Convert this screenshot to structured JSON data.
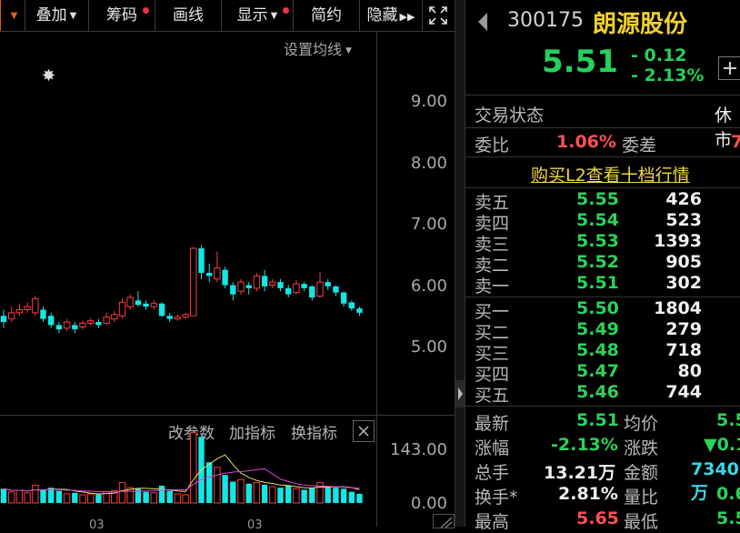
{
  "toolbar": {
    "stack_label": "叠加",
    "chips_label": "筹码",
    "draw_label": "画线",
    "display_label": "显示",
    "simple_label": "简约",
    "hide_label": "隐藏"
  },
  "chart": {
    "ma_setting_label": "设置均线",
    "price_ticks": [
      "9.00",
      "8.00",
      "7.00",
      "6.00",
      "5.00"
    ],
    "volume_ticks": [
      "143.00",
      "0.00"
    ],
    "indicator_buttons": {
      "change_params": "改参数",
      "add_indicator": "加指标",
      "switch_indicator": "换指标"
    },
    "x_ticks": [
      "03",
      "03"
    ]
  },
  "stock": {
    "code": "300175",
    "name": "朗源股份",
    "price": "5.51",
    "change": "- 0.12",
    "change_pct": "- 2.13%"
  },
  "status": {
    "trade_status_label": "交易状态",
    "trade_status_value": "休市",
    "commission_ratio_label": "委比",
    "commission_ratio_value": "1.06%",
    "commission_diff_label": "委差",
    "commission_diff_value": "7"
  },
  "l2_link": "购买L2查看十档行情",
  "order_book": {
    "asks": [
      {
        "label": "卖五",
        "price": "5.55",
        "volume": "426"
      },
      {
        "label": "卖四",
        "price": "5.54",
        "volume": "523"
      },
      {
        "label": "卖三",
        "price": "5.53",
        "volume": "1393"
      },
      {
        "label": "卖二",
        "price": "5.52",
        "volume": "905"
      },
      {
        "label": "卖一",
        "price": "5.51",
        "volume": "302"
      }
    ],
    "bids": [
      {
        "label": "买一",
        "price": "5.50",
        "volume": "1804"
      },
      {
        "label": "买二",
        "price": "5.49",
        "volume": "279"
      },
      {
        "label": "买三",
        "price": "5.48",
        "volume": "718"
      },
      {
        "label": "买四",
        "price": "5.47",
        "volume": "80"
      },
      {
        "label": "买五",
        "price": "5.46",
        "volume": "744"
      }
    ]
  },
  "stats": {
    "latest_label": "最新",
    "latest_value": "5.51",
    "avg_label": "均价",
    "avg_value": "5.5",
    "pct_label": "涨幅",
    "pct_value": "-2.13%",
    "chg_label": "涨跌",
    "chg_value": "▼0.1",
    "vol_label": "总手",
    "vol_value": "13.21万",
    "amount_label": "金额",
    "amount_value": "7340万",
    "turnover_label": "换手*",
    "turnover_value": "2.81%",
    "vol_ratio_label": "量比",
    "vol_ratio_value": "0.6",
    "high_label": "最高",
    "high_value": "5.65",
    "low_label": "最低",
    "low_value": "5.5"
  },
  "colors": {
    "up": "#ff3b3b",
    "down": "#14e6e6",
    "price_green": "#26d05a",
    "name_yellow": "#f0d030",
    "ma_yellow": "#e8e060",
    "ma_magenta": "#e040e0"
  },
  "chart_data": {
    "type": "candlestick",
    "y_axis_ticks": [
      5.0,
      6.0,
      7.0,
      8.0,
      9.0
    ],
    "candles": [
      {
        "o": 5.5,
        "c": 5.4,
        "h": 5.6,
        "l": 5.3
      },
      {
        "o": 5.45,
        "c": 5.55,
        "h": 5.65,
        "l": 5.4
      },
      {
        "o": 5.55,
        "c": 5.6,
        "h": 5.7,
        "l": 5.5
      },
      {
        "o": 5.6,
        "c": 5.65,
        "h": 5.72,
        "l": 5.55
      },
      {
        "o": 5.55,
        "c": 5.78,
        "h": 5.82,
        "l": 5.5
      },
      {
        "o": 5.6,
        "c": 5.45,
        "h": 5.65,
        "l": 5.4
      },
      {
        "o": 5.5,
        "c": 5.35,
        "h": 5.55,
        "l": 5.3
      },
      {
        "o": 5.35,
        "c": 5.28,
        "h": 5.4,
        "l": 5.22
      },
      {
        "o": 5.3,
        "c": 5.4,
        "h": 5.45,
        "l": 5.25
      },
      {
        "o": 5.35,
        "c": 5.28,
        "h": 5.4,
        "l": 5.22
      },
      {
        "o": 5.32,
        "c": 5.38,
        "h": 5.42,
        "l": 5.28
      },
      {
        "o": 5.38,
        "c": 5.42,
        "h": 5.46,
        "l": 5.34
      },
      {
        "o": 5.4,
        "c": 5.35,
        "h": 5.45,
        "l": 5.3
      },
      {
        "o": 5.38,
        "c": 5.48,
        "h": 5.55,
        "l": 5.35
      },
      {
        "o": 5.45,
        "c": 5.52,
        "h": 5.58,
        "l": 5.4
      },
      {
        "o": 5.5,
        "c": 5.72,
        "h": 5.78,
        "l": 5.45
      },
      {
        "o": 5.65,
        "c": 5.8,
        "h": 5.85,
        "l": 5.6
      },
      {
        "o": 5.75,
        "c": 5.68,
        "h": 5.9,
        "l": 5.65
      },
      {
        "o": 5.7,
        "c": 5.65,
        "h": 5.75,
        "l": 5.6
      },
      {
        "o": 5.65,
        "c": 5.7,
        "h": 5.75,
        "l": 5.6
      },
      {
        "o": 5.7,
        "c": 5.5,
        "h": 5.72,
        "l": 5.48
      },
      {
        "o": 5.5,
        "c": 5.45,
        "h": 5.55,
        "l": 5.4
      },
      {
        "o": 5.45,
        "c": 5.48,
        "h": 5.52,
        "l": 5.42
      },
      {
        "o": 5.48,
        "c": 5.52,
        "h": 5.55,
        "l": 5.45
      },
      {
        "o": 5.5,
        "c": 6.6,
        "h": 6.62,
        "l": 5.5
      },
      {
        "o": 6.6,
        "c": 6.2,
        "h": 6.65,
        "l": 6.1
      },
      {
        "o": 6.2,
        "c": 6.15,
        "h": 6.35,
        "l": 6.05
      },
      {
        "o": 6.1,
        "c": 6.28,
        "h": 6.55,
        "l": 6.05
      },
      {
        "o": 6.25,
        "c": 6.0,
        "h": 6.3,
        "l": 5.95
      },
      {
        "o": 6.0,
        "c": 5.85,
        "h": 6.05,
        "l": 5.75
      },
      {
        "o": 5.9,
        "c": 6.05,
        "h": 6.1,
        "l": 5.85
      },
      {
        "o": 6.0,
        "c": 5.95,
        "h": 6.05,
        "l": 5.85
      },
      {
        "o": 5.95,
        "c": 6.15,
        "h": 6.2,
        "l": 5.9
      },
      {
        "o": 6.15,
        "c": 5.98,
        "h": 6.25,
        "l": 5.9
      },
      {
        "o": 6.0,
        "c": 6.05,
        "h": 6.1,
        "l": 5.95
      },
      {
        "o": 6.05,
        "c": 5.95,
        "h": 6.1,
        "l": 5.9
      },
      {
        "o": 5.95,
        "c": 5.85,
        "h": 6.0,
        "l": 5.8
      },
      {
        "o": 5.88,
        "c": 6.02,
        "h": 6.08,
        "l": 5.85
      },
      {
        "o": 6.02,
        "c": 5.95,
        "h": 6.05,
        "l": 5.9
      },
      {
        "o": 5.98,
        "c": 5.8,
        "h": 6.0,
        "l": 5.75
      },
      {
        "o": 5.82,
        "c": 6.05,
        "h": 6.22,
        "l": 5.8
      },
      {
        "o": 6.05,
        "c": 5.98,
        "h": 6.1,
        "l": 5.92
      },
      {
        "o": 5.98,
        "c": 5.88,
        "h": 6.0,
        "l": 5.82
      },
      {
        "o": 5.88,
        "c": 5.7,
        "h": 5.9,
        "l": 5.65
      },
      {
        "o": 5.72,
        "c": 5.62,
        "h": 5.75,
        "l": 5.58
      },
      {
        "o": 5.62,
        "c": 5.55,
        "h": 5.65,
        "l": 5.5
      }
    ],
    "volumes": [
      28,
      22,
      25,
      20,
      35,
      26,
      30,
      24,
      18,
      20,
      16,
      18,
      17,
      22,
      24,
      40,
      30,
      28,
      22,
      20,
      34,
      24,
      18,
      16,
      138,
      130,
      80,
      70,
      55,
      42,
      46,
      38,
      40,
      36,
      32,
      30,
      34,
      28,
      26,
      30,
      40,
      32,
      30,
      28,
      22,
      18
    ]
  }
}
